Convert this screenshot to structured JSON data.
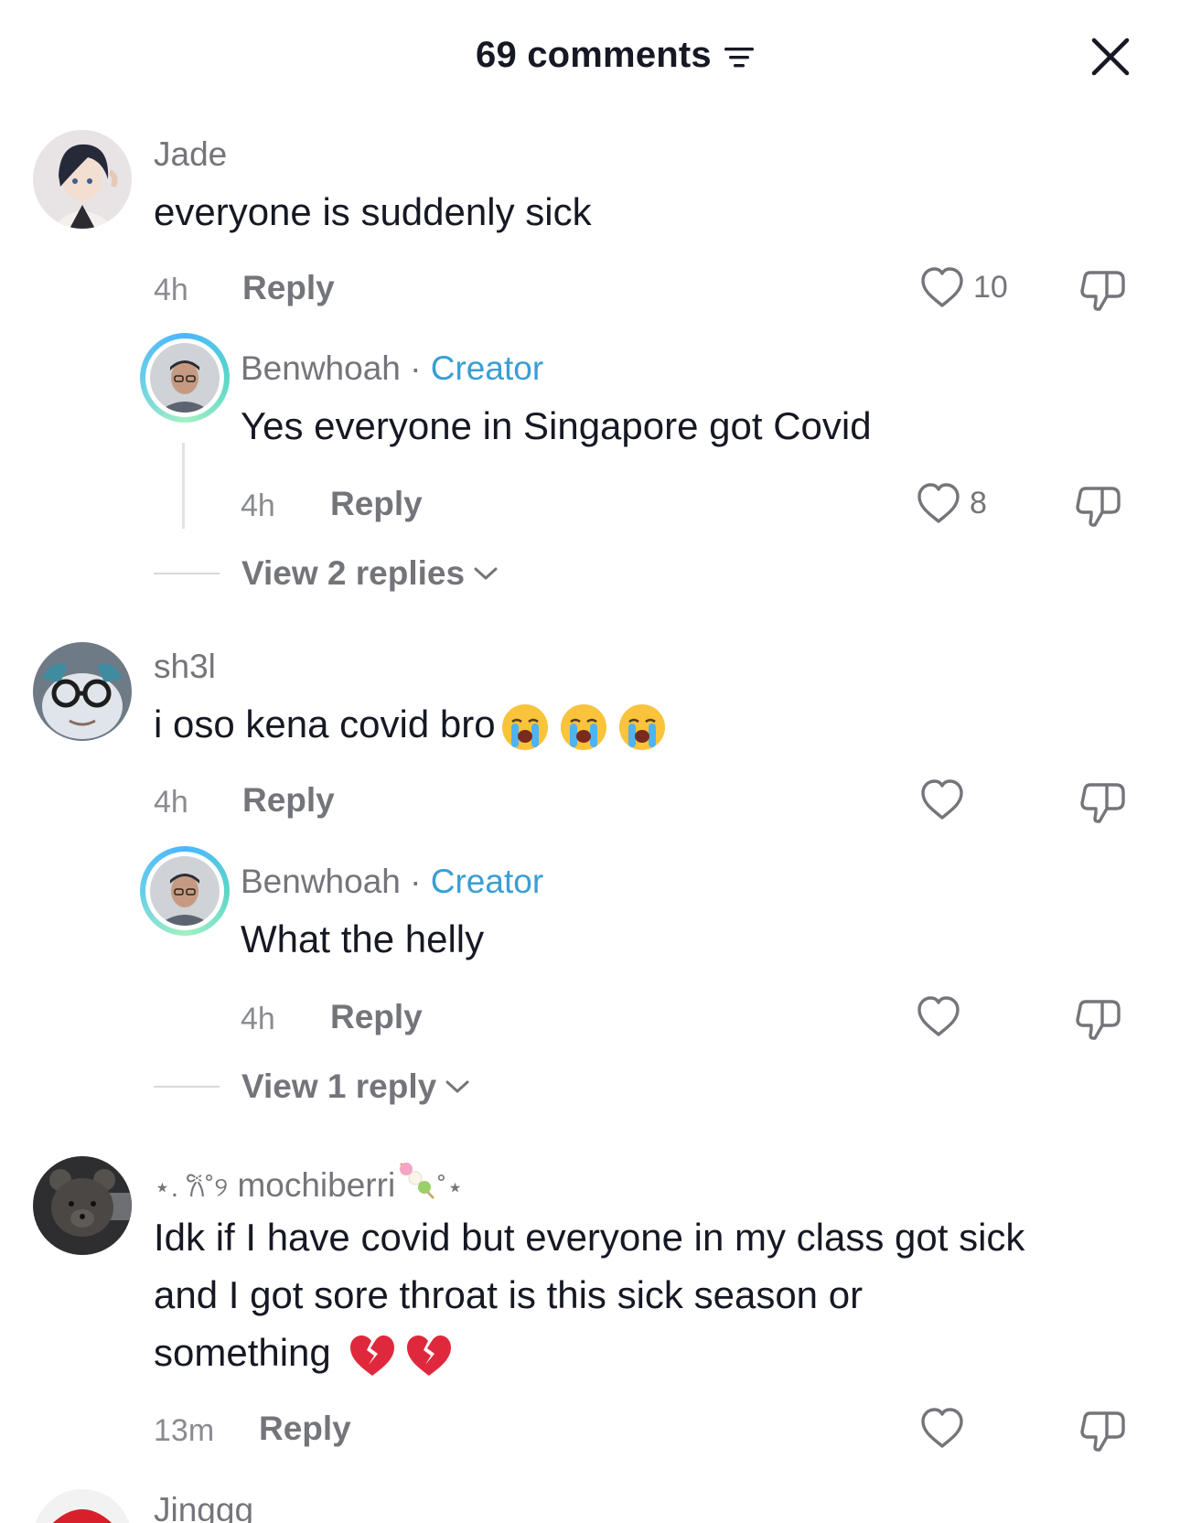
{
  "header": {
    "count_label": "69 comments"
  },
  "comments": [
    {
      "username": "Jade",
      "text": "everyone is suddenly sick",
      "time": "4h",
      "reply_label": "Reply",
      "likes": "10",
      "reply": {
        "username": "Benwhoah",
        "badge": "Creator",
        "text": "Yes everyone in Singapore got Covid",
        "time": "4h",
        "reply_label": "Reply",
        "likes": "8"
      },
      "view_more": "View 2 replies"
    },
    {
      "username": "sh3l",
      "text": "i oso kena covid bro",
      "time": "4h",
      "reply_label": "Reply",
      "reply": {
        "username": "Benwhoah",
        "badge": "Creator",
        "text": "What the helly",
        "time": "4h",
        "reply_label": "Reply"
      },
      "view_more": "View 1 reply"
    },
    {
      "username_prefix": "⋆. 𐙚˚୨",
      "username": "mochiberri",
      "username_suffix": "˚⋆",
      "text_line1": "Idk if I have covid but everyone in my class got sick",
      "text_line2": "and I got sore throat is this sick season or",
      "text_line3": "something",
      "time": "13m",
      "reply_label": "Reply"
    },
    {
      "username": "Jinggg"
    }
  ],
  "colors": {
    "creator": "#3a9ed4",
    "muted": "#74757a",
    "text": "#161823"
  }
}
